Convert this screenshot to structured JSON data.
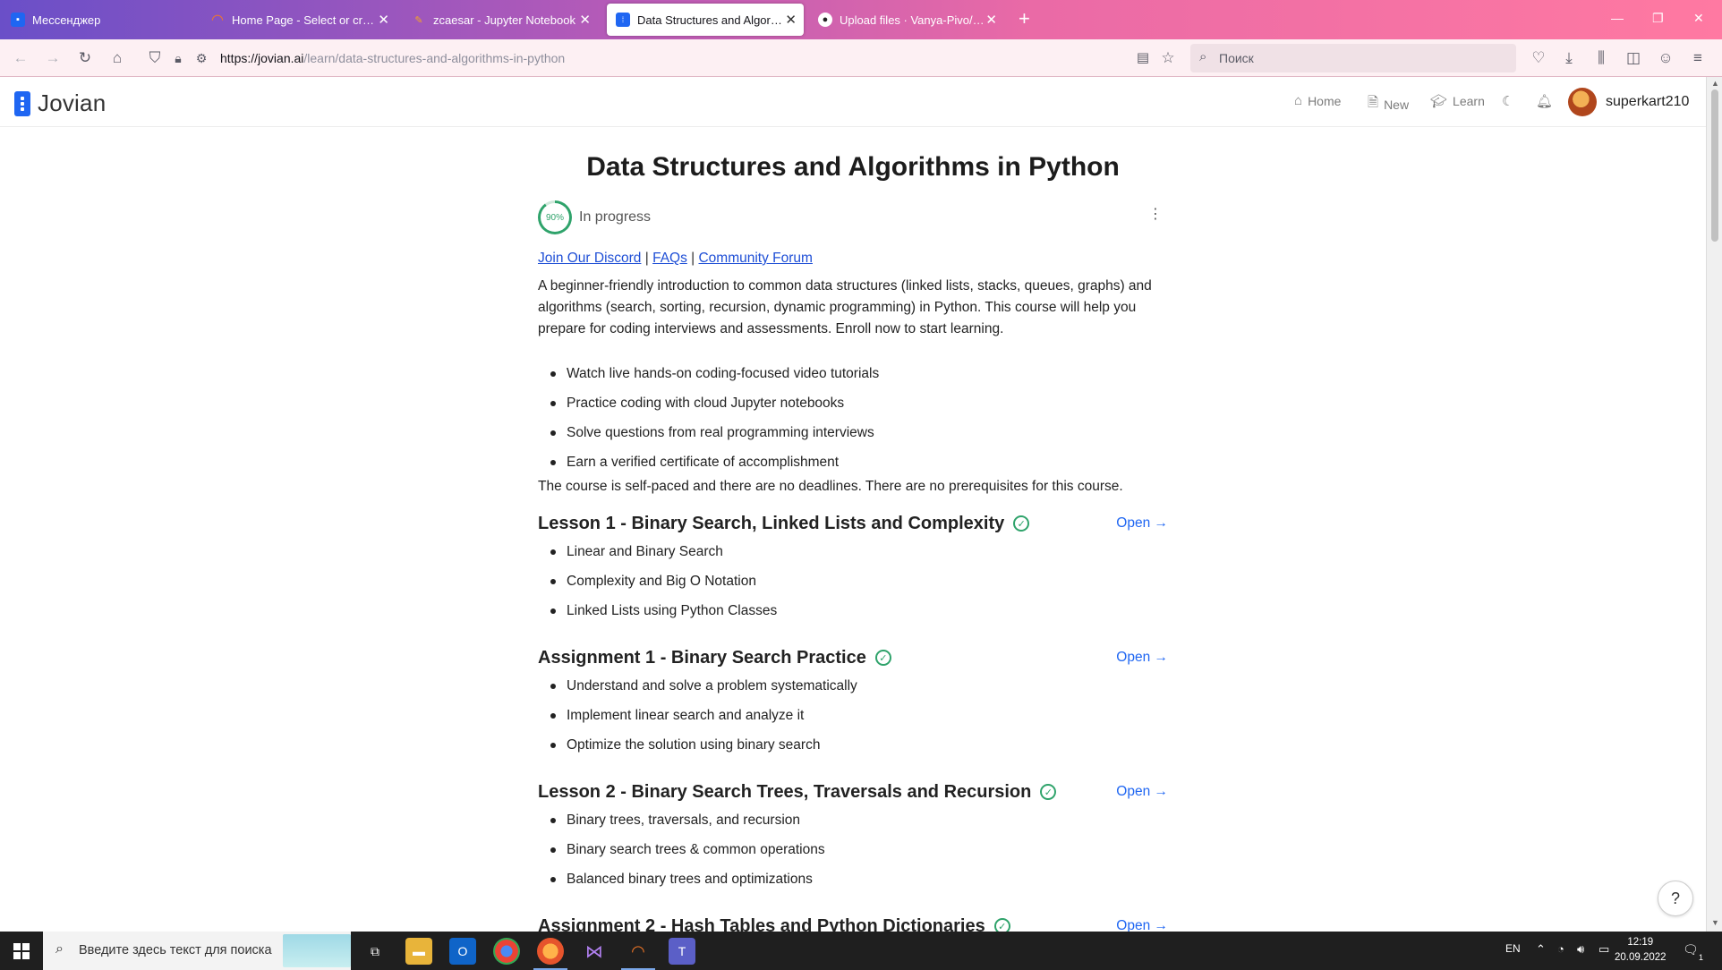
{
  "browser": {
    "tabs": [
      {
        "title": "Мессенджер",
        "favicon_color": "#1f66f2"
      },
      {
        "title": "Home Page - Select or create a",
        "favicon_color": "#f37726"
      },
      {
        "title": "zcaesar - Jupyter Notebook",
        "favicon_color": "#f37726"
      },
      {
        "title": "Data Structures and Algorithms",
        "favicon_color": "#1f66f2"
      },
      {
        "title": "Upload files · Vanya-Pivo/new_r",
        "favicon_color": "#ffffff"
      }
    ],
    "url_host": "https://jovian.ai",
    "url_path": "/learn/data-structures-and-algorithms-in-python",
    "search_placeholder": "Поиск"
  },
  "site": {
    "logo_text": "Jovian",
    "nav": [
      {
        "label": "Home",
        "icon": "home-icon"
      },
      {
        "label": "New",
        "icon": "file-plus-icon"
      },
      {
        "label": "Learn",
        "icon": "graduation-cap-icon"
      }
    ],
    "username": "superkart210"
  },
  "course": {
    "title": "Data Structures and Algorithms in Python",
    "progress_percent": 90,
    "progress_label": "90%",
    "status": "In progress",
    "links": [
      "Join Our Discord",
      "FAQs",
      "Community Forum"
    ],
    "description": "A beginner-friendly introduction to common data structures (linked lists, stacks, queues, graphs) and algorithms (search, sorting, recursion, dynamic programming) in Python. This course will help you prepare for coding interviews and assessments. Enroll now to start learning.",
    "features": [
      "Watch live hands-on coding-focused video tutorials",
      "Practice coding with cloud Jupyter notebooks",
      "Solve questions from real programming interviews",
      "Earn a verified certificate of accomplishment"
    ],
    "note": "The course is self-paced and there are no deadlines. There are no prerequisites for this course.",
    "open_label": "Open →",
    "sections": [
      {
        "title": "Lesson 1 - Binary Search, Linked Lists and Complexity",
        "items": [
          "Linear and Binary Search",
          "Complexity and Big O Notation",
          "Linked Lists using Python Classes"
        ]
      },
      {
        "title": "Assignment 1 - Binary Search Practice",
        "items": [
          "Understand and solve a problem systematically",
          "Implement linear search and analyze it",
          "Optimize the solution using binary search"
        ]
      },
      {
        "title": "Lesson 2 - Binary Search Trees, Traversals and Recursion",
        "items": [
          "Binary trees, traversals, and recursion",
          "Binary search trees & common operations",
          "Balanced binary trees and optimizations"
        ]
      },
      {
        "title": "Assignment 2 - Hash Tables and Python Dictionaries",
        "items": []
      }
    ],
    "help_label": "?"
  },
  "taskbar": {
    "search_placeholder": "Введите здесь текст для поиска",
    "language": "EN",
    "time": "12:19",
    "date": "20.09.2022",
    "notification_count": "1"
  }
}
